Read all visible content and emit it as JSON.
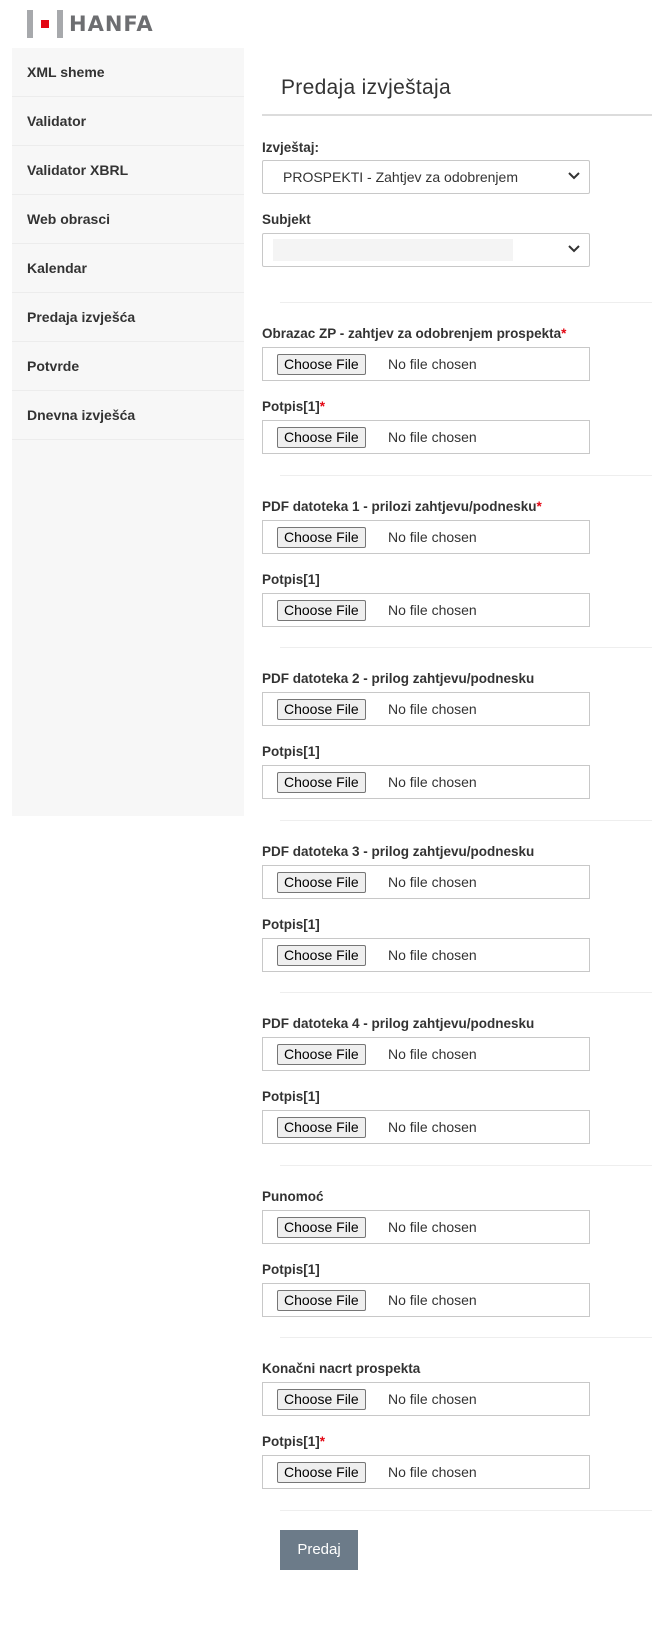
{
  "brand": {
    "name": "HANFA",
    "accent": "#e30613"
  },
  "sidebar": {
    "items": [
      {
        "label": "XML sheme"
      },
      {
        "label": "Validator"
      },
      {
        "label": "Validator XBRL"
      },
      {
        "label": "Web obrasci"
      },
      {
        "label": "Kalendar"
      },
      {
        "label": "Predaja izvješća"
      },
      {
        "label": "Potvrde"
      },
      {
        "label": "Dnevna izvješća"
      }
    ]
  },
  "main": {
    "title": "Predaja izvještaja",
    "report": {
      "label": "Izvještaj:",
      "value": "PROSPEKTI - Zahtjev za odobrenjem"
    },
    "subject": {
      "label": "Subjekt",
      "value": ""
    },
    "file_button_label": "Choose File",
    "file_status": "No file chosen",
    "required_mark": "*",
    "groups": [
      {
        "label": "Obrazac ZP - zahtjev za odobrenjem prospekta",
        "required": true,
        "sig_label": "Potpis[1]",
        "sig_required": true
      },
      {
        "label": "PDF datoteka 1 - prilozi zahtjevu/podnesku",
        "required": true,
        "sig_label": "Potpis[1]",
        "sig_required": false
      },
      {
        "label": "PDF datoteka 2 - prilog zahtjevu/podnesku",
        "required": false,
        "sig_label": "Potpis[1]",
        "sig_required": false
      },
      {
        "label": "PDF datoteka 3 - prilog zahtjevu/podnesku",
        "required": false,
        "sig_label": "Potpis[1]",
        "sig_required": false
      },
      {
        "label": "PDF datoteka 4 - prilog zahtjevu/podnesku",
        "required": false,
        "sig_label": "Potpis[1]",
        "sig_required": false
      },
      {
        "label": "Punomoć",
        "required": false,
        "sig_label": "Potpis[1]",
        "sig_required": false
      },
      {
        "label": "Konačni nacrt prospekta",
        "required": false,
        "sig_label": "Potpis[1]",
        "sig_required": true
      }
    ],
    "submit_label": "Predaj"
  }
}
